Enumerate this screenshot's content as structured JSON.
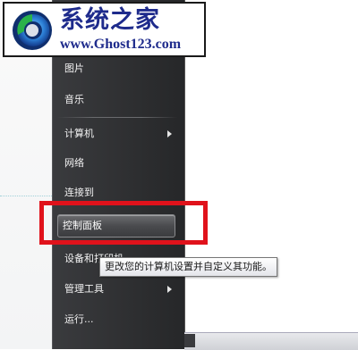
{
  "watermark": {
    "title": "系统之家",
    "url": "www.Ghost123.com"
  },
  "start_menu": {
    "items": [
      {
        "label": "图片",
        "has_submenu": false
      },
      {
        "label": "音乐",
        "has_submenu": false
      },
      {
        "label": "计算机",
        "has_submenu": true
      },
      {
        "label": "网络",
        "has_submenu": false
      },
      {
        "label": "连接到",
        "has_submenu": false
      },
      {
        "label": "控制面板",
        "has_submenu": false,
        "highlighted": true
      },
      {
        "label": "设备和打印机",
        "has_submenu": false
      },
      {
        "label": "管理工具",
        "has_submenu": true
      },
      {
        "label": "运行...",
        "has_submenu": false
      }
    ]
  },
  "tooltip": {
    "text": "更改您的计算机设置并自定义其功能。"
  },
  "colors": {
    "annotation_red": "#e0121b",
    "menu_bg": "#2e2f31",
    "logo_blue": "#1e2b8c"
  }
}
